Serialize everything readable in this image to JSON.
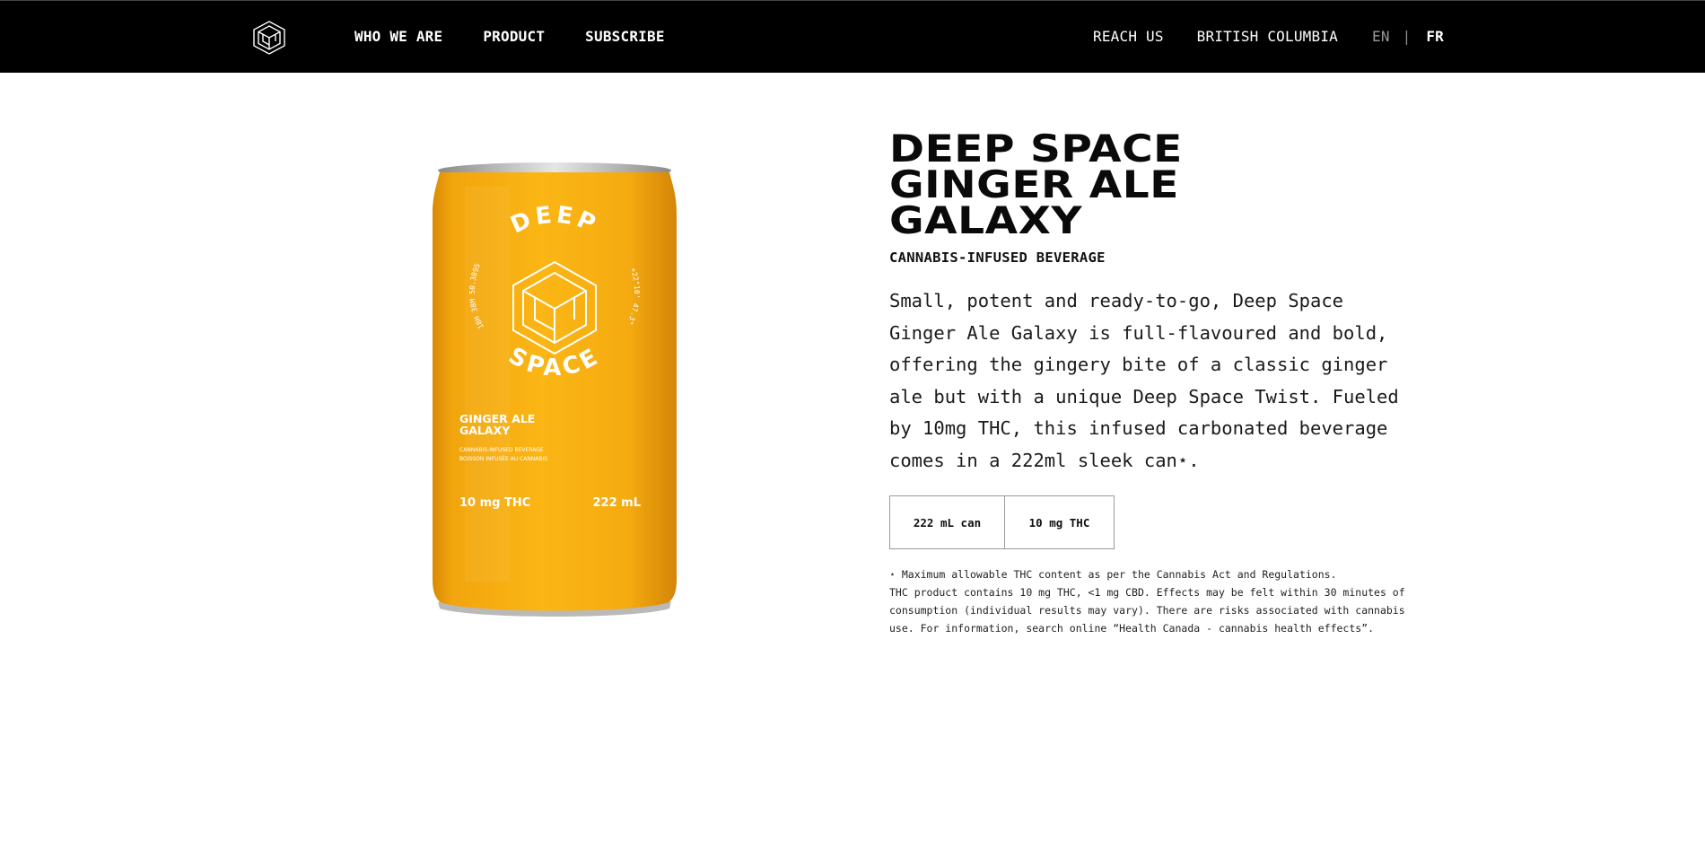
{
  "nav": {
    "left": [
      "WHO WE ARE",
      "PRODUCT",
      "SUBSCRIBE"
    ],
    "right": [
      "REACH US",
      "BRITISH COLUMBIA"
    ],
    "lang": {
      "en": "EN",
      "separator": "|",
      "fr": "FR"
    }
  },
  "can": {
    "brand_top": "DEEP",
    "brand_bottom": "SPACE",
    "ring_left": "18H 38M 50.389S",
    "ring_right": "+22°10' 47.3\"",
    "flavor_line1": "GINGER ALE",
    "flavor_line2": "GALAXY",
    "sub_line1": "CANNABIS-INFUSED BEVERAGE",
    "sub_line2": "BOISSON INFUSÉE AU CANNABIS",
    "thc": "10 mg THC",
    "volume": "222 mL",
    "colors": {
      "body": "#F6A90F",
      "rim": "#BFBFBF"
    }
  },
  "product": {
    "title_lines": [
      "DEEP SPACE",
      "GINGER ALE",
      "GALAXY"
    ],
    "subtitle": "CANNABIS-INFUSED BEVERAGE",
    "description": "Small, potent and ready-to-go, Deep Space Ginger Ale Galaxy is full-flavoured and bold, offering the gingery bite of a classic ginger ale but with a unique Deep Space Twist. Fueled by 10mg THC, this infused carbonated beverage comes in a 222ml sleek can⋆.",
    "specs": {
      "size": "222 mL can",
      "thc": "10 mg THC"
    },
    "note1": "⋆ Maximum allowable THC content as per the Cannabis Act and Regulations.",
    "note2": "THC product contains 10 mg THC, <1 mg CBD. Effects may be felt within 30 minutes of consumption (individual results may vary). There are risks associated with cannabis use. For information, search online “Health Canada - cannabis health effects”."
  }
}
